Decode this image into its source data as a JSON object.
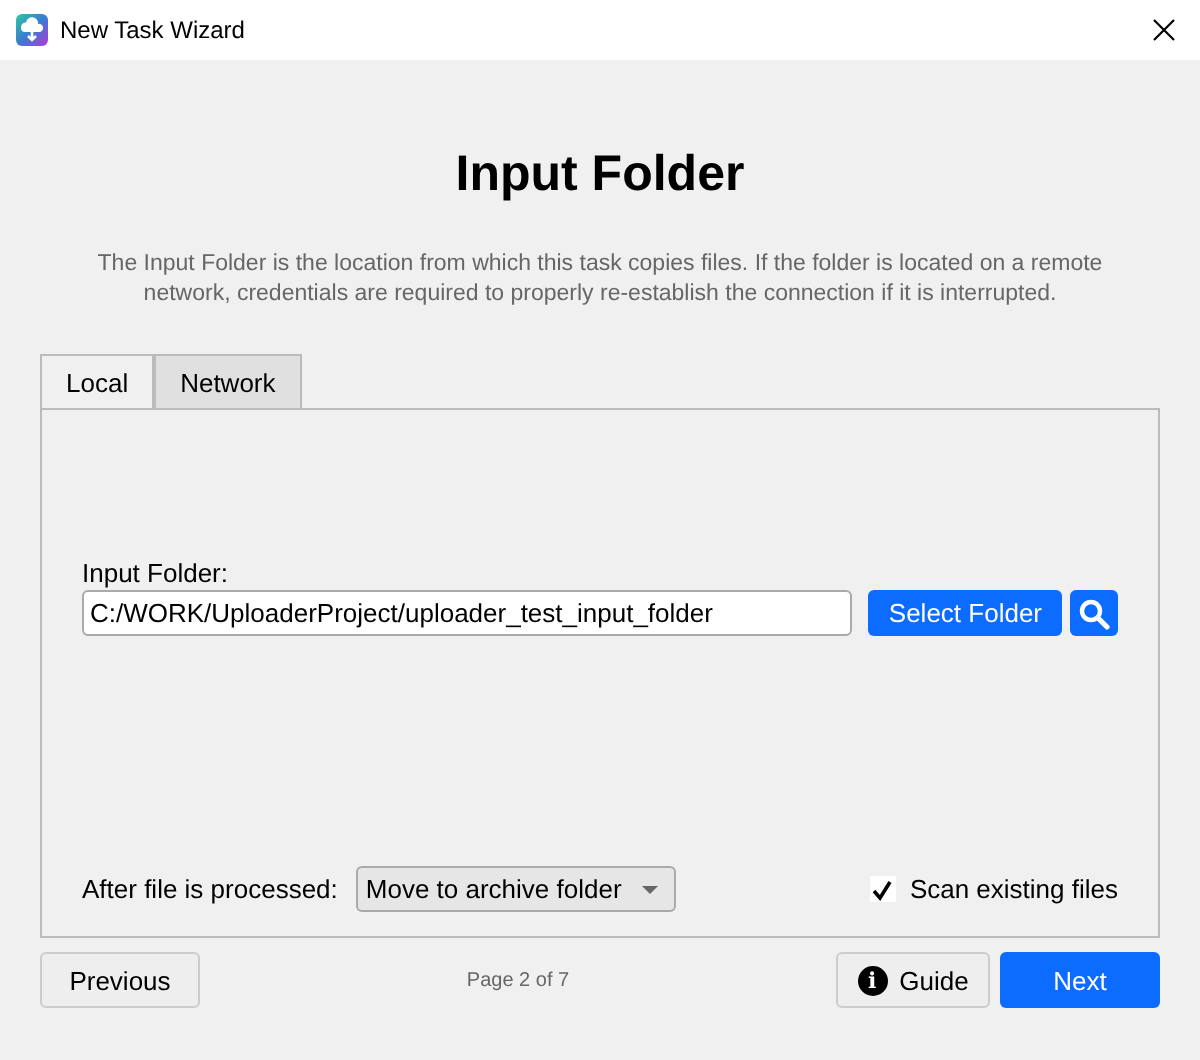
{
  "window": {
    "title": "New Task Wizard"
  },
  "heading": "Input Folder",
  "description": "The Input Folder is the location from which this task copies files. If the folder is located on a remote network, credentials are required to properly re-establish the connection if it is interrupted.",
  "tabs": [
    {
      "label": "Local",
      "selected": true
    },
    {
      "label": "Network",
      "selected": false
    }
  ],
  "input_folder": {
    "label": "Input Folder:",
    "value": "C:/WORK/UploaderProject/uploader_test_input_folder",
    "button": "Select Folder"
  },
  "after_processed": {
    "label": "After file is processed:",
    "value": "Move to archive folder"
  },
  "scan_existing": {
    "label": "Scan existing files",
    "checked": true
  },
  "footer": {
    "previous": "Previous",
    "page": "Page 2 of 7",
    "guide_icon": "i",
    "guide": "Guide",
    "next": "Next"
  }
}
